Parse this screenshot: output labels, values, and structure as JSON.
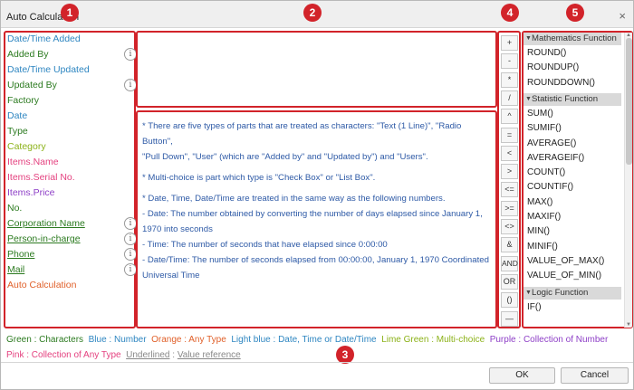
{
  "window": {
    "title": "Auto Calculation",
    "close_glyph": "×"
  },
  "fields": [
    {
      "label": "Date/Time Added",
      "color": "#2e86c1",
      "underline": false,
      "info": false
    },
    {
      "label": "Added By",
      "color": "#2b7a1f",
      "underline": false,
      "info": true
    },
    {
      "label": "Date/Time Updated",
      "color": "#2e86c1",
      "underline": false,
      "info": false
    },
    {
      "label": "Updated By",
      "color": "#2b7a1f",
      "underline": false,
      "info": true
    },
    {
      "label": "Factory",
      "color": "#2b7a1f",
      "underline": false,
      "info": false
    },
    {
      "label": "Date",
      "color": "#2e86c1",
      "underline": false,
      "info": false
    },
    {
      "label": "Type",
      "color": "#2b7a1f",
      "underline": false,
      "info": false
    },
    {
      "label": "Category",
      "color": "#8cb219",
      "underline": false,
      "info": false
    },
    {
      "label": "Items.Name",
      "color": "#e4417f",
      "underline": false,
      "info": false
    },
    {
      "label": "Items.Serial No.",
      "color": "#e4417f",
      "underline": false,
      "info": false
    },
    {
      "label": "Items.Price",
      "color": "#8e3fc7",
      "underline": false,
      "info": false
    },
    {
      "label": "No.",
      "color": "#2b7a1f",
      "underline": false,
      "info": false
    },
    {
      "label": "Corporation Name",
      "color": "#2b7a1f",
      "underline": true,
      "info": true
    },
    {
      "label": "Person-in-charge",
      "color": "#2b7a1f",
      "underline": true,
      "info": true
    },
    {
      "label": "Phone",
      "color": "#2b7a1f",
      "underline": true,
      "info": true
    },
    {
      "label": "Mail",
      "color": "#2b7a1f",
      "underline": true,
      "info": true
    },
    {
      "label": "Auto Calculation",
      "color": "#e0602a",
      "underline": false,
      "info": false
    }
  ],
  "info_glyph": "i",
  "help": {
    "p1": "*  There are five types of parts that are treated as characters: \"Text (1 Line)\", \"Radio Button\",",
    "p1b": "   \"Pull Down\", \"User\" (which are \"Added by\" and \"Updated by\") and \"Users\".",
    "p2": "*  Multi-choice is part which type is \"Check Box\" or \"List Box\".",
    "p3": "*  Date, Time, Date/Time are treated in the same way as the following numbers.",
    "p3a": "   - Date: The number obtained by converting the number of days elapsed since January 1,",
    "p3b": "   1970 into seconds",
    "p3c": "   - Time: The number of seconds that have elapsed since 0:00:00",
    "p3d": "   - Date/Time: The number of seconds elapsed from 00:00:00, January 1, 1970 Coordinated",
    "p3e": "   Universal Time"
  },
  "operators": [
    "+",
    "-",
    "*",
    "/",
    "^",
    "=",
    "<",
    ">",
    "<=",
    ">=",
    "<>",
    "&",
    "AND",
    "OR",
    "()",
    "—"
  ],
  "functions": {
    "math_title": "Mathematics Function",
    "math": [
      "ROUND()",
      "ROUNDUP()",
      "ROUNDDOWN()"
    ],
    "stat_title": "Statistic Function",
    "stat": [
      "SUM()",
      "SUMIF()",
      "AVERAGE()",
      "AVERAGEIF()",
      "COUNT()",
      "COUNTIF()",
      "MAX()",
      "MAXIF()",
      "MIN()",
      "MINIF()",
      "VALUE_OF_MAX()",
      "VALUE_OF_MIN()"
    ],
    "logic_title": "Logic Function",
    "logic": [
      "IF()"
    ]
  },
  "badges": [
    "1",
    "2",
    "3",
    "4",
    "5"
  ],
  "legend": {
    "line1": [
      {
        "text": "Green",
        "color": "#2b7a1f",
        "sep": " : "
      },
      {
        "text": "Characters",
        "color": "#2b7a1f",
        "sep": "  "
      },
      {
        "text": "Blue",
        "color": "#2e86c1",
        "sep": " : "
      },
      {
        "text": "Number",
        "color": "#2e86c1",
        "sep": "  "
      },
      {
        "text": "Orange",
        "color": "#e0602a",
        "sep": " : "
      },
      {
        "text": "Any Type",
        "color": "#e0602a",
        "sep": "  "
      },
      {
        "text": "Light blue",
        "color": "#2e86c1",
        "sep": " : "
      },
      {
        "text": "Date, Time or Date/Time",
        "color": "#2e86c1",
        "sep": "  "
      },
      {
        "text": "Lime Green",
        "color": "#8cb219",
        "sep": " : "
      },
      {
        "text": "Multi-choice",
        "color": "#8cb219",
        "sep": "  "
      },
      {
        "text": "Purple",
        "color": "#8e3fc7",
        "sep": " : "
      },
      {
        "text": "Collection of Number",
        "color": "#8e3fc7",
        "sep": ""
      }
    ],
    "line2": [
      {
        "text": "Pink",
        "color": "#e4417f",
        "sep": " : "
      },
      {
        "text": "Collection of Any Type",
        "color": "#e4417f",
        "sep": "  "
      },
      {
        "text": "Underlined",
        "color": "#888888",
        "sep": " : ",
        "underline": true
      },
      {
        "text": "Value reference",
        "color": "#888888",
        "sep": "",
        "underline": true
      }
    ]
  },
  "buttons": {
    "ok": "OK",
    "cancel": "Cancel"
  },
  "colors": {
    "accent_red": "#d2232a",
    "category_bg": "#d9d9d9"
  }
}
